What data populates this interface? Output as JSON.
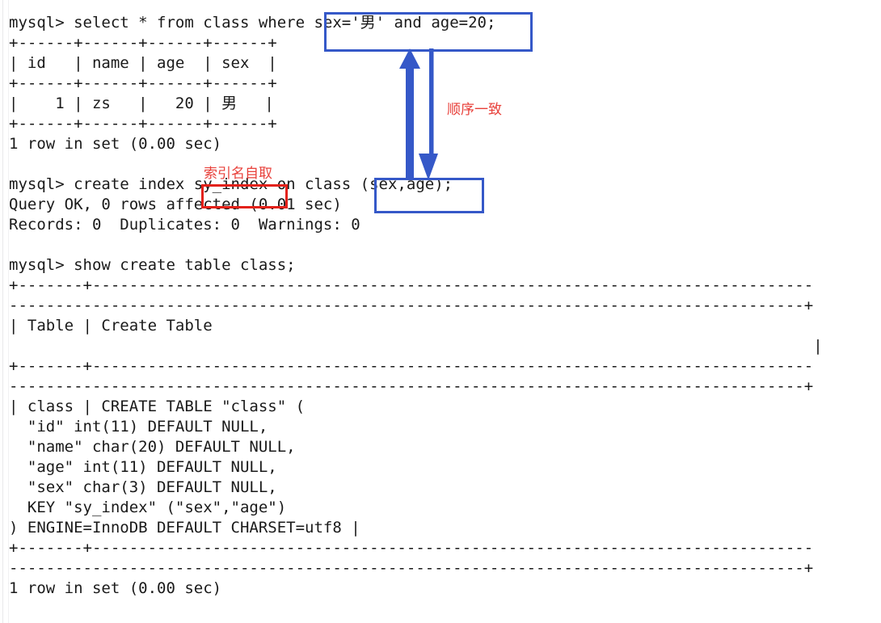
{
  "window": {
    "kind": "mysql-terminal-screenshot",
    "background": "#ffffff"
  },
  "terminal": {
    "lines": [
      "mysql> select * from class where sex='男' and age=20;",
      "+------+------+------+------+",
      "| id   | name | age  | sex  |",
      "+------+------+------+------+",
      "|    1 | zs   |   20 | 男   |",
      "+------+------+------+------+",
      "1 row in set (0.00 sec)",
      "",
      "mysql> create index sy_index on class (sex,age);",
      "Query OK, 0 rows affected (0.01 sec)",
      "Records: 0  Duplicates: 0  Warnings: 0",
      "",
      "mysql> show create table class;",
      "+-------+------------------------------------------------------------------------------",
      "--------------------------------------------------------------------------------------+",
      "| Table | Create Table",
      "                                                                                       |",
      "+-------+------------------------------------------------------------------------------",
      "--------------------------------------------------------------------------------------+",
      "| class | CREATE TABLE \"class\" (",
      "  \"id\" int(11) DEFAULT NULL,",
      "  \"name\" char(20) DEFAULT NULL,",
      "  \"age\" int(11) DEFAULT NULL,",
      "  \"sex\" char(3) DEFAULT NULL,",
      "  KEY \"sy_index\" (\"sex\",\"age\")",
      ") ENGINE=InnoDB DEFAULT CHARSET=utf8 |",
      "+-------+------------------------------------------------------------------------------",
      "--------------------------------------------------------------------------------------+",
      "1 row in set (0.00 sec)"
    ]
  },
  "annotations": {
    "blue_color": "#3558c8",
    "red_color": "#e32119",
    "red_text_color": "#e8403a",
    "highlight_where_clause": "sex='男' and age=20;",
    "highlight_index_columns": "(sex,age);",
    "highlight_index_name": "sy_index",
    "label_order_match": "顺序一致",
    "label_index_name_free": "索引名自取"
  }
}
